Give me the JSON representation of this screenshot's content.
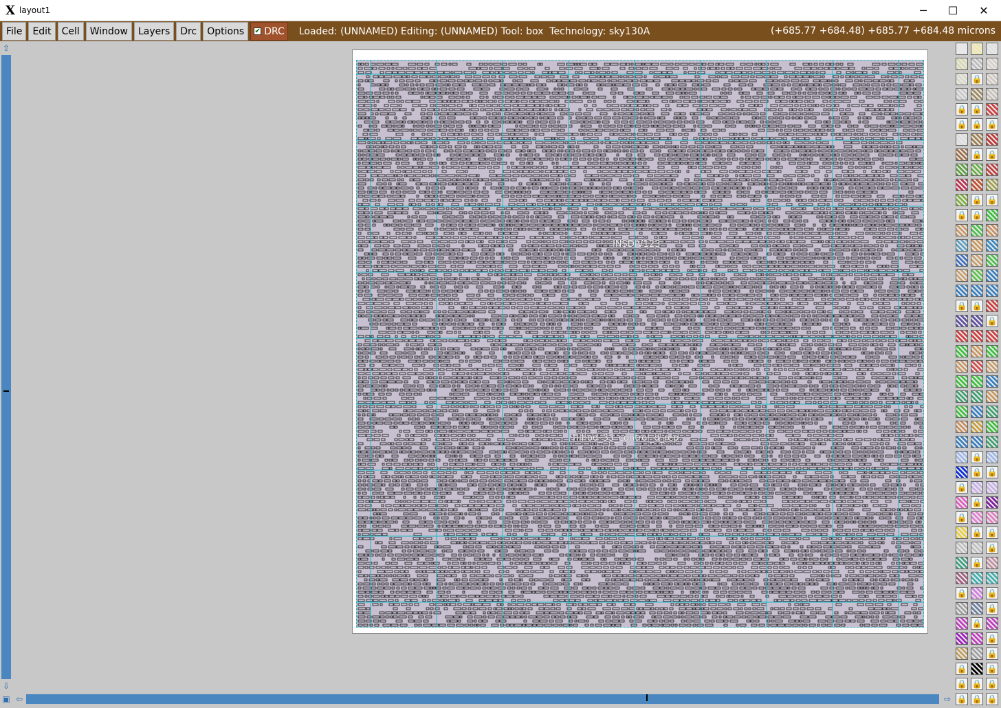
{
  "window": {
    "title": "layout1",
    "minimize_glyph": "─",
    "maximize_glyph": "☐",
    "close_glyph": "✕"
  },
  "menubar": {
    "items": [
      "File",
      "Edit",
      "Cell",
      "Window",
      "Layers",
      "Drc",
      "Options"
    ],
    "drc_toggle_label": "DRC",
    "status": "Loaded: (UNNAMED) Editing: (UNNAMED) Tool: box  Technology: sky130A",
    "coordinates": "(+685.77 +684.48) +685.77 +684.48 microns"
  },
  "layout": {
    "labels": [
      "INSDIV123",
      "Tilhod_33_control_d_rep"
    ]
  },
  "palette": {
    "swatches": [
      [
        "#e8e8e8",
        "#f0e8a0",
        "#e0e0e0"
      ],
      [
        "#d8d8b0",
        "#bcbcbc",
        "#d8d0c8"
      ],
      [
        "#d8d8c8",
        "lock",
        "#d0c8c0"
      ],
      [
        "#c8c8c8",
        "#a08c60",
        "#c8c0b8"
      ],
      [
        "lock",
        "lock",
        "#d04040"
      ],
      [
        "lock",
        "lock",
        "lock"
      ],
      [
        "#dcdcdc",
        "#a08050",
        "#c03838"
      ],
      [
        "#a0704a",
        "lock",
        "lock"
      ],
      [
        "#5ca040",
        "#6ab048",
        "#c04040"
      ],
      [
        "#c03050",
        "#c05030",
        "#a0a050"
      ],
      [
        "#80b040",
        "lock",
        "lock"
      ],
      [
        "lock",
        "lock",
        "#40c040"
      ],
      [
        "#c89868",
        "#50c050",
        "#c89060"
      ],
      [
        "#60a0c0",
        "#c89860",
        "#3a8ac0"
      ],
      [
        "#4070c0",
        "#c8a070",
        "#50c050"
      ],
      [
        "#c8a070",
        "#60c050",
        "#3a80c0"
      ],
      [
        "#3a80c0",
        "#3a80c0",
        "#3a80c0"
      ],
      [
        "lock",
        "lock",
        "#d04040"
      ],
      [
        "#6050a0",
        "#6050a0",
        "lock"
      ],
      [
        "#d04040",
        "#d04040",
        "#d04040"
      ],
      [
        "#40c040",
        "#c89860",
        "#40c040"
      ],
      [
        "#c89868",
        "#d05050",
        "#c8a070"
      ],
      [
        "#40c040",
        "#40c040",
        "#3a80c0"
      ],
      [
        "#40a070",
        "#40a070",
        "#c89860"
      ],
      [
        "#40c040",
        "#3a80c0",
        "#40a070"
      ],
      [
        "#c89060",
        "#c8a040",
        "#40c040"
      ],
      [
        "#3a80c0",
        "#3a80c0",
        "#40a070"
      ],
      [
        "#a0b8e8",
        "lock",
        "#a0b8e8"
      ],
      [
        "#1030e0",
        "lock",
        "lock"
      ],
      [
        "lock",
        "#c8b0e8",
        "#c8b0e8"
      ],
      [
        "#e060c0",
        "lock",
        "#8020a0"
      ],
      [
        "lock",
        "#e080d0",
        "#e080c0"
      ],
      [
        "#e8d040",
        "lock",
        "lock"
      ],
      [
        "#c0c0c0",
        "#c0c0c0",
        "lock"
      ],
      [
        "#40a080",
        "lock",
        "#c090a0"
      ],
      [
        "#a06080",
        "#40b0b0",
        "#40b0b0"
      ],
      [
        "lock",
        "#d080e0",
        "lock"
      ],
      [
        "#a0a0a0",
        "#7080a0",
        "lock"
      ],
      [
        "#c040c0",
        "lock",
        "#c040c0"
      ],
      [
        "#a020c0",
        "#c040c0",
        "lock"
      ],
      [
        "#c0a060",
        "#a0a0a0",
        "lock"
      ],
      [
        "lock",
        "#000000",
        "lock"
      ],
      [
        "lock",
        "lock",
        "lock"
      ],
      [
        "lock",
        "lock",
        "lock"
      ]
    ]
  }
}
